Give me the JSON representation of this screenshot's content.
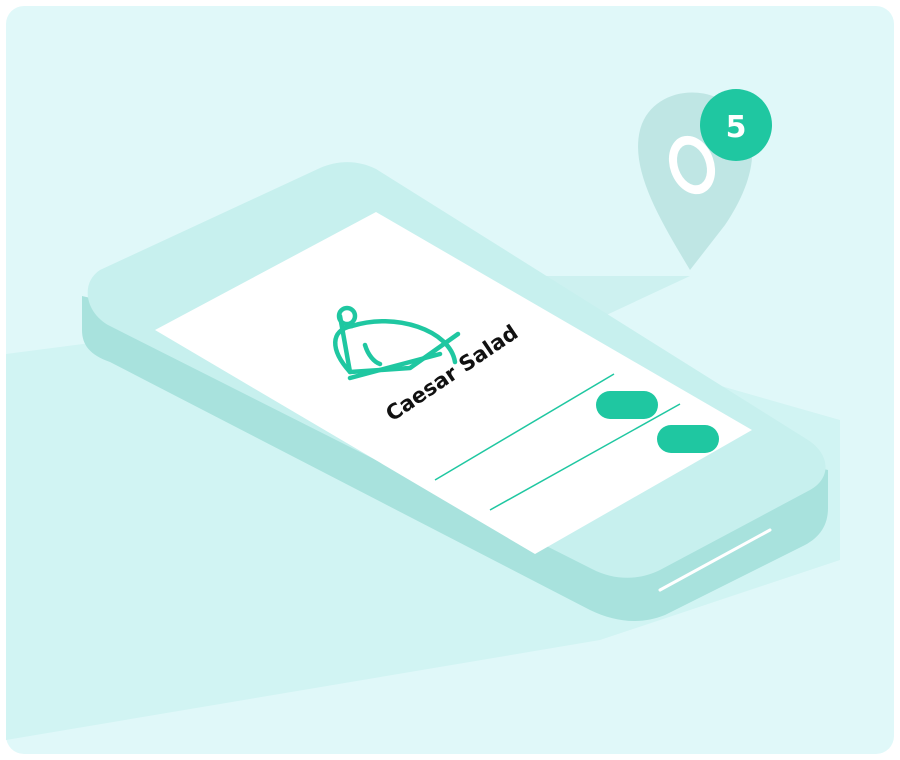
{
  "screen": {
    "dish_name": "Caesar Salad",
    "dish_icon": "cloche-icon"
  },
  "map_pin": {
    "icon": "location-pin-icon",
    "badge_count": "5"
  },
  "colors": {
    "background": "#e0f8f9",
    "phone_body": "#c7f0ee",
    "phone_side": "#a8e2dd",
    "accent": "#1fc7a1",
    "pin": "#bfe6e4"
  }
}
